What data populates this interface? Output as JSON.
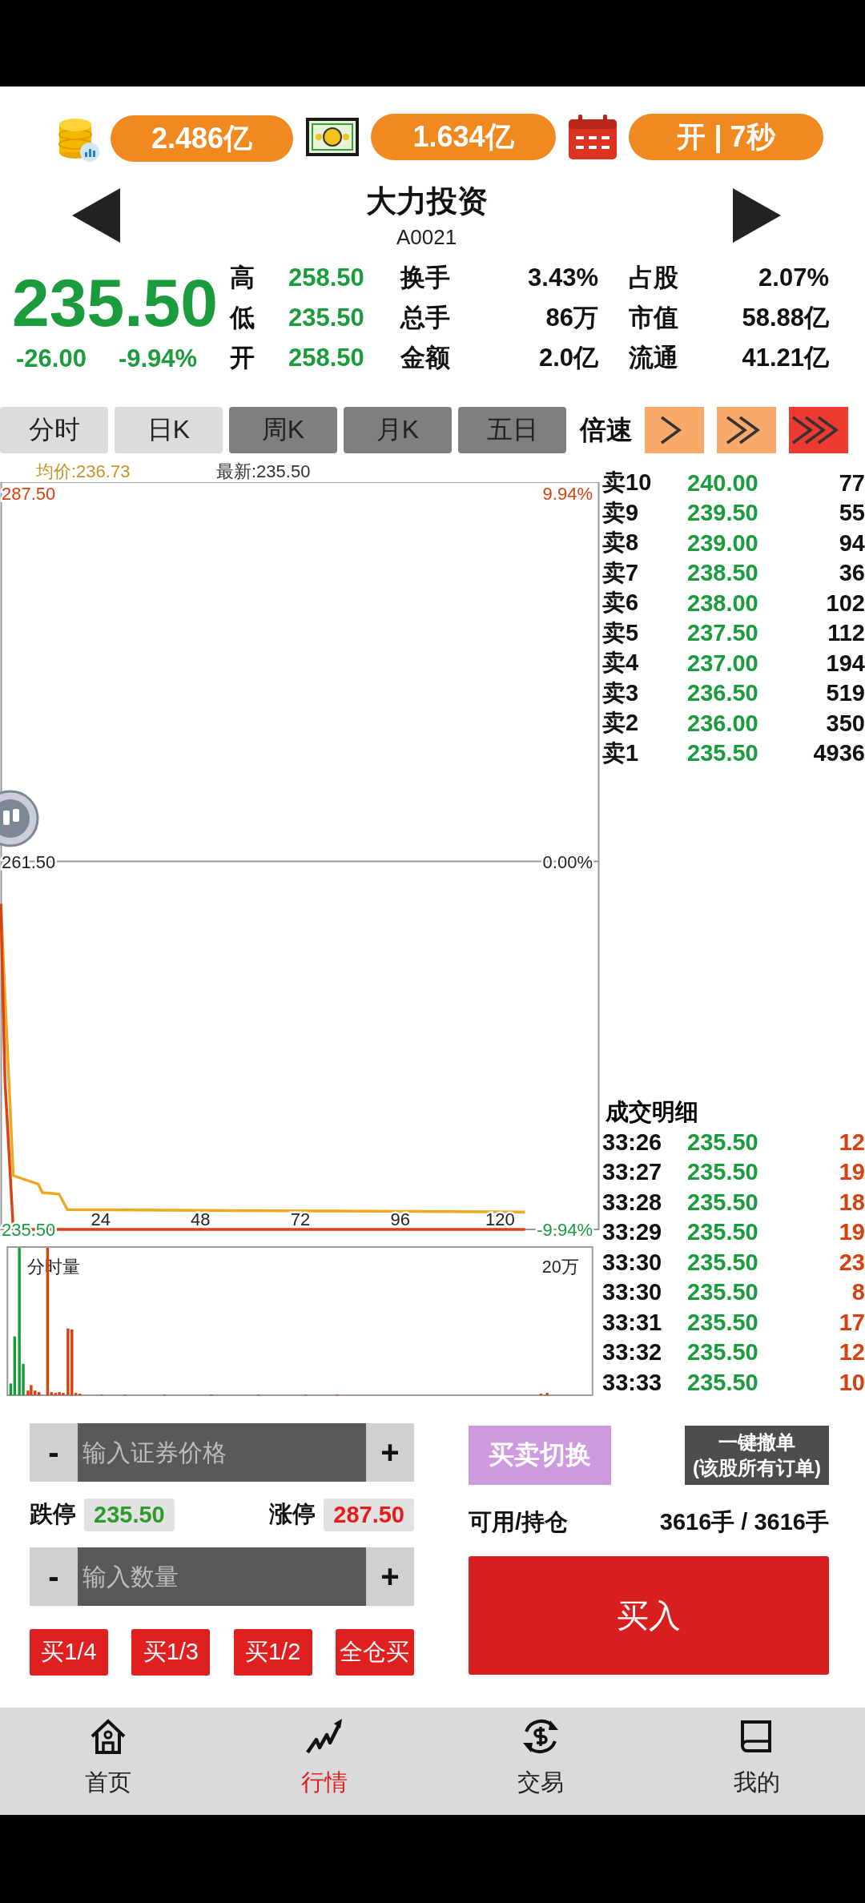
{
  "stats": [
    {
      "kind": "coins",
      "value": "2.486亿"
    },
    {
      "kind": "banknote",
      "value": "1.634亿"
    },
    {
      "kind": "calendar",
      "value": "开 | 7秒"
    }
  ],
  "stock": {
    "name": "大力投资",
    "code": "A0021",
    "price": "235.50",
    "change": "-26.00",
    "change_pct": "-9.94%"
  },
  "quote_fields": [
    {
      "label": "高",
      "value": "258.50",
      "kind": "price"
    },
    {
      "label": "换手",
      "value": "3.43%",
      "kind": "plain"
    },
    {
      "label": "占股",
      "value": "2.07%",
      "kind": "plain"
    },
    {
      "label": "低",
      "value": "235.50",
      "kind": "price"
    },
    {
      "label": "总手",
      "value": "86万",
      "kind": "plain"
    },
    {
      "label": "市值",
      "value": "58.88亿",
      "kind": "plain"
    },
    {
      "label": "开",
      "value": "258.50",
      "kind": "price"
    },
    {
      "label": "金额",
      "value": "2.0亿",
      "kind": "plain"
    },
    {
      "label": "流通",
      "value": "41.21亿",
      "kind": "plain"
    }
  ],
  "period_tabs": [
    {
      "label": "分时",
      "disabled": false
    },
    {
      "label": "日K",
      "disabled": false
    },
    {
      "label": "周K",
      "disabled": true
    },
    {
      "label": "月K",
      "disabled": true
    },
    {
      "label": "五日",
      "disabled": true
    }
  ],
  "speed": {
    "label": "倍速",
    "buttons": [
      {
        "kind": "single",
        "selected": false
      },
      {
        "kind": "double",
        "selected": false
      },
      {
        "kind": "triple",
        "selected": true
      }
    ]
  },
  "chart": {
    "legend": [
      {
        "text": "均价:236.73",
        "color": "#c8922a"
      },
      {
        "text": "最新:235.50",
        "color": "#333333"
      }
    ],
    "chart_data": {
      "type": "line",
      "x": [
        0,
        1,
        3,
        9,
        10,
        14,
        16,
        126
      ],
      "series": [
        {
          "color": "#d84315",
          "values": [
            258.5,
            246,
            235.5,
            235.5,
            235.5,
            235.5,
            235.5,
            235.5
          ]
        },
        {
          "color": "#f0a820",
          "values": [
            258.5,
            252,
            239.3,
            238.7,
            238.1,
            238.0,
            236.9,
            236.73
          ]
        }
      ],
      "xlim": [
        0,
        144
      ],
      "ylim": [
        235.5,
        288.3
      ],
      "xticks": [
        24,
        48,
        72,
        96,
        120
      ],
      "yticks": [
        {
          "value": 287.5,
          "label": "287.50"
        },
        {
          "value": 261.5,
          "label": "261.50"
        },
        {
          "value": 235.5,
          "label": "235.50"
        }
      ]
    },
    "percent_labels": [
      "9.94%",
      "0.00%",
      "-9.94%"
    ],
    "volume_label": "分时量",
    "volume_max": "20万"
  },
  "order_book": [
    {
      "label": "卖10",
      "price": "240.00",
      "volume": "77"
    },
    {
      "label": "卖9",
      "price": "239.50",
      "volume": "55"
    },
    {
      "label": "卖8",
      "price": "239.00",
      "volume": "94"
    },
    {
      "label": "卖7",
      "price": "238.50",
      "volume": "36"
    },
    {
      "label": "卖6",
      "price": "238.00",
      "volume": "102"
    },
    {
      "label": "卖5",
      "price": "237.50",
      "volume": "112"
    },
    {
      "label": "卖4",
      "price": "237.00",
      "volume": "194"
    },
    {
      "label": "卖3",
      "price": "236.50",
      "volume": "519"
    },
    {
      "label": "卖2",
      "price": "236.00",
      "volume": "350"
    },
    {
      "label": "卖1",
      "price": "235.50",
      "volume": "4936"
    }
  ],
  "trades": {
    "title": "成交明细",
    "rows": [
      {
        "time": "33:26",
        "price": "235.50",
        "volume": "12"
      },
      {
        "time": "33:27",
        "price": "235.50",
        "volume": "19"
      },
      {
        "time": "33:28",
        "price": "235.50",
        "volume": "18"
      },
      {
        "time": "33:29",
        "price": "235.50",
        "volume": "19"
      },
      {
        "time": "33:30",
        "price": "235.50",
        "volume": "23"
      },
      {
        "time": "33:30",
        "price": "235.50",
        "volume": "8"
      },
      {
        "time": "33:31",
        "price": "235.50",
        "volume": "17"
      },
      {
        "time": "33:32",
        "price": "235.50",
        "volume": "12"
      },
      {
        "time": "33:33",
        "price": "235.50",
        "volume": "10"
      }
    ]
  },
  "order_form": {
    "minus": "-",
    "plus": "+",
    "price_placeholder": "输入证券价格",
    "quantity_placeholder": "输入数量",
    "limits": [
      {
        "label": "跌停",
        "value": "235.50",
        "kind": "down"
      },
      {
        "label": "涨停",
        "value": "287.50",
        "kind": "up"
      }
    ],
    "quick_buttons": [
      "买1/4",
      "买1/3",
      "买1/2",
      "全仓买"
    ],
    "switch_button": "买卖切换",
    "cancel_button": [
      "一键撤单",
      "(该股所有订单)"
    ],
    "position_label": "可用/持仓",
    "position_value": "3616手 / 3616手",
    "buy_button": "买入"
  },
  "nav": [
    {
      "kind": "home",
      "label": "首页",
      "selected": false
    },
    {
      "kind": "trend",
      "label": "行情",
      "selected": true
    },
    {
      "kind": "exchange",
      "label": "交易",
      "selected": false
    },
    {
      "kind": "book",
      "label": "我的",
      "selected": false
    }
  ]
}
